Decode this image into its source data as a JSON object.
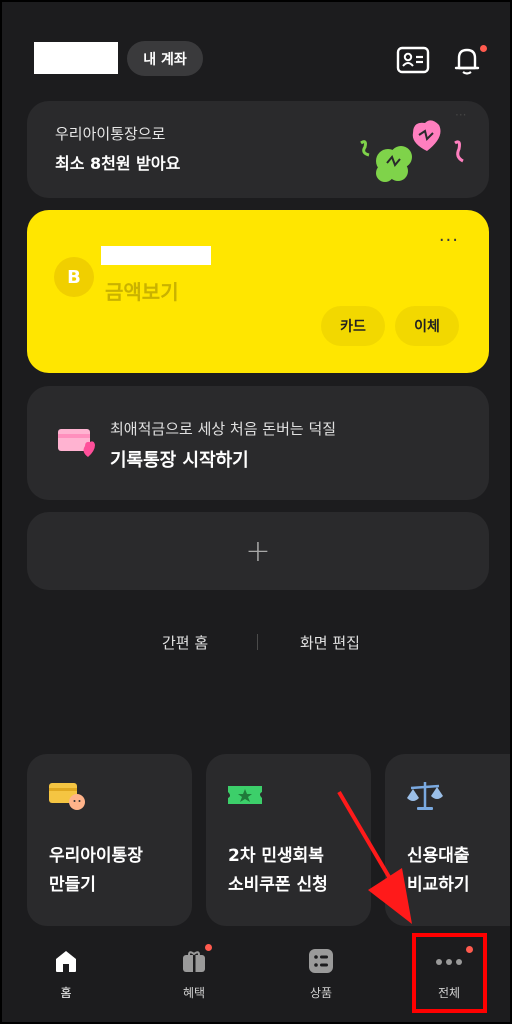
{
  "header": {
    "account_pill": "내 계좌",
    "icons": [
      "id-card-icon",
      "bell-icon"
    ]
  },
  "promo": {
    "line1": "우리아이통장으로",
    "line2": "최소 8천원 받아요"
  },
  "account_card": {
    "logo_letter": "B",
    "amount_label": "금액보기",
    "more": "···",
    "buttons": [
      "카드",
      "이체"
    ],
    "color": "#ffe600"
  },
  "record_card": {
    "line1": "최애적금으로 세상 처음 돈버는 덕질",
    "line2": "기록통장 시작하기"
  },
  "add_card": {
    "plus": "+"
  },
  "links": {
    "simple_home": "간편 홈",
    "edit_screen": "화면 편집"
  },
  "tiles": [
    {
      "line1": "우리아이통장",
      "line2": "만들기",
      "icon": "card-baby-icon"
    },
    {
      "line1": "2차 민생회복",
      "line2": "소비쿠폰 신청",
      "icon": "coupon-star-icon"
    },
    {
      "line1": "신용대출",
      "line2": "비교하기",
      "icon": "scale-icon"
    }
  ],
  "bottom_nav": [
    {
      "label": "홈",
      "icon": "home-icon"
    },
    {
      "label": "혜택",
      "icon": "gift-icon"
    },
    {
      "label": "상품",
      "icon": "list-icon"
    },
    {
      "label": "전체",
      "icon": "more-dots-icon"
    }
  ],
  "colors": {
    "background": "#1c1c1e",
    "card": "#2a2a2c",
    "accent_yellow": "#ffe600",
    "highlight_red": "#ff0000",
    "notification": "#ff5a4e"
  }
}
